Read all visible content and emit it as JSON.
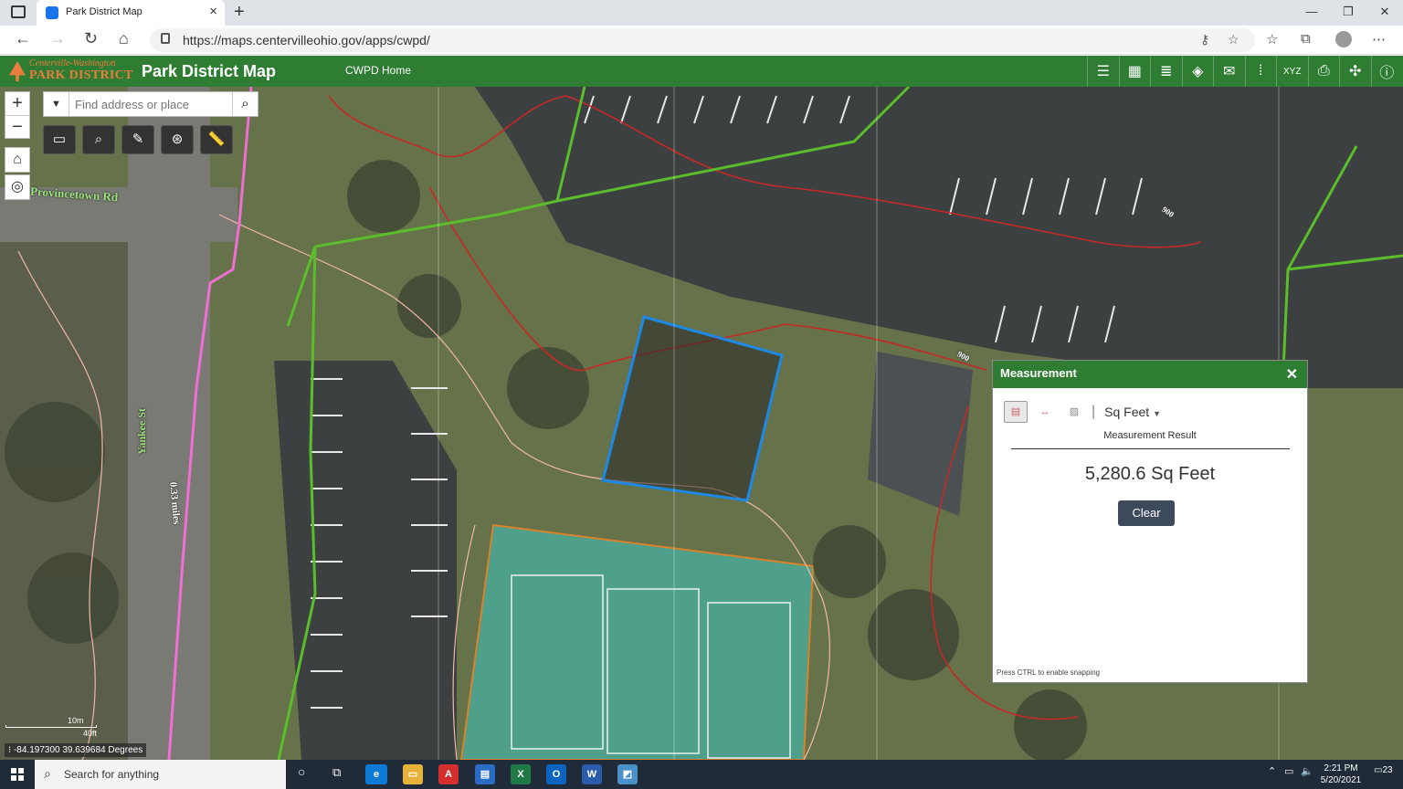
{
  "browser": {
    "tab_title": "Park District Map",
    "url": "https://maps.centervilleohio.gov/apps/cwpd/"
  },
  "app": {
    "logo_line1": "Centerville-Washington",
    "logo_line2": "PARK DISTRICT",
    "title": "Park District Map",
    "home_link": "CWPD Home",
    "widgets": [
      "legend-icon",
      "basemap-gallery-icon",
      "layer-list-icon",
      "layers-icon",
      "share-icon",
      "query-icon",
      "coordinate-icon",
      "print-icon",
      "directions-icon",
      "about-icon"
    ]
  },
  "map": {
    "search_placeholder": "Find address or place",
    "road_label_1": "Provincetown Rd",
    "road_label_2": "Yankee St",
    "distance_label": "0.33 miles",
    "contour_label": "900",
    "scale_top": "10m",
    "scale_bottom": "40ft",
    "coordinates": "-84.197300 39.639684 Degrees"
  },
  "measurement": {
    "title": "Measurement",
    "unit": "Sq Feet",
    "result_label": "Measurement Result",
    "value": "5,280.6 Sq Feet",
    "clear_label": "Clear",
    "snap_hint": "Press CTRL to enable snapping"
  },
  "taskbar": {
    "search_text": "Search for anything",
    "time": "2:21 PM",
    "date": "5/20/2021",
    "notifications": "23"
  }
}
